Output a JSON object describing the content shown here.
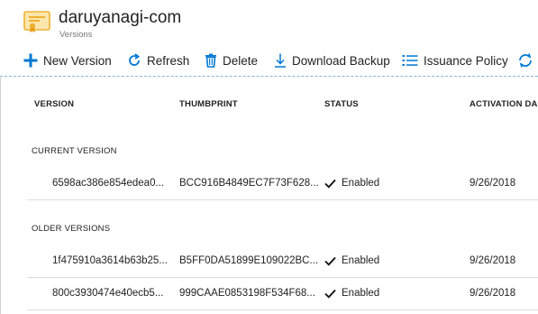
{
  "header": {
    "title": "daruyanagi-com",
    "subtitle": "Versions",
    "icon": "certificate-icon"
  },
  "toolbar": {
    "new_version": "New Version",
    "refresh": "Refresh",
    "delete": "Delete",
    "download_backup": "Download Backup",
    "issuance_policy": "Issuance Policy"
  },
  "columns": {
    "version": "VERSION",
    "thumbprint": "THUMBPRINT",
    "status": "STATUS",
    "activation_date": "ACTIVATION DA"
  },
  "sections": {
    "current": "CURRENT VERSION",
    "older": "OLDER VERSIONS"
  },
  "current_versions": [
    {
      "version": "6598ac386e854edea0...",
      "thumbprint": "BCC916B4849EC7F73F628...",
      "status": "Enabled",
      "activation_date": "9/26/2018"
    }
  ],
  "older_versions": [
    {
      "version": "1f475910a3614b63b25...",
      "thumbprint": "B5FF0DA51899E109022BC...",
      "status": "Enabled",
      "activation_date": "9/26/2018"
    },
    {
      "version": "800c3930474e40ecb5...",
      "thumbprint": "999CAAE0853198F534F68...",
      "status": "Enabled",
      "activation_date": "9/26/2018"
    }
  ],
  "colors": {
    "accent": "#0078d4",
    "certificate": "#f0b030"
  }
}
